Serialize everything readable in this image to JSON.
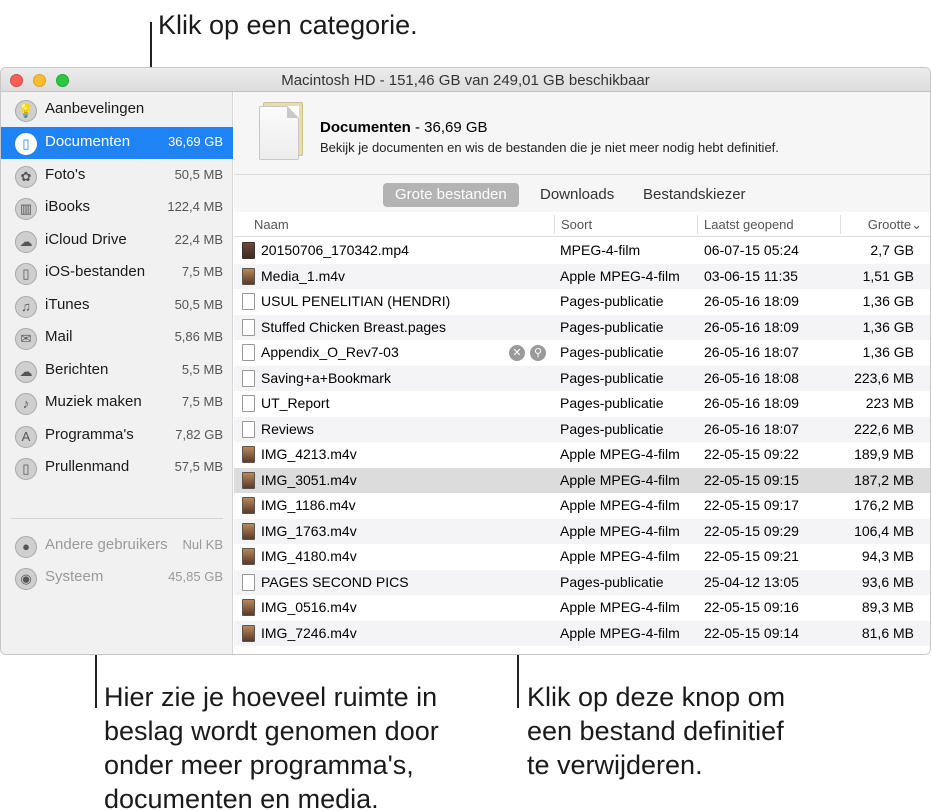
{
  "callouts": {
    "top": "Klik op een categorie.",
    "left": [
      "Hier zie je hoeveel ruimte in",
      "beslag wordt genomen door",
      "onder meer programma's,",
      "documenten en media."
    ],
    "right": [
      "Klik op deze knop om",
      "een bestand definitief",
      "te verwijderen."
    ]
  },
  "window": {
    "title": "Macintosh HD - 151,46 GB van 249,01 GB beschikbaar"
  },
  "sidebar": {
    "items": [
      {
        "label": "Aanbevelingen",
        "size": "",
        "icon": "lightbulb-icon"
      },
      {
        "label": "Documenten",
        "size": "36,69 GB",
        "icon": "document-icon"
      },
      {
        "label": "Foto's",
        "size": "50,5 MB",
        "icon": "photos-icon"
      },
      {
        "label": "iBooks",
        "size": "122,4 MB",
        "icon": "book-icon"
      },
      {
        "label": "iCloud Drive",
        "size": "22,4 MB",
        "icon": "cloud-icon"
      },
      {
        "label": "iOS-bestanden",
        "size": "7,5 MB",
        "icon": "phone-icon"
      },
      {
        "label": "iTunes",
        "size": "50,5 MB",
        "icon": "music-note-icon"
      },
      {
        "label": "Mail",
        "size": "5,86 MB",
        "icon": "stamp-icon"
      },
      {
        "label": "Berichten",
        "size": "5,5 MB",
        "icon": "speech-bubble-icon"
      },
      {
        "label": "Muziek maken",
        "size": "7,5 MB",
        "icon": "guitar-icon"
      },
      {
        "label": "Programma's",
        "size": "7,82 GB",
        "icon": "app-store-icon"
      },
      {
        "label": "Prullenmand",
        "size": "57,5 MB",
        "icon": "trash-icon"
      },
      {
        "label": "Andere gebruikers",
        "size": "Nul KB",
        "icon": "users-icon"
      },
      {
        "label": "Systeem",
        "size": "45,85 GB",
        "icon": "disk-icon"
      }
    ]
  },
  "header": {
    "title": "Documenten",
    "size": " - 36,69 GB",
    "description": "Bekijk je documenten en wis de bestanden die je niet meer nodig hebt definitief."
  },
  "tabs": [
    "Grote bestanden",
    "Downloads",
    "Bestandskiezer"
  ],
  "table": {
    "columns": [
      "Naam",
      "Soort",
      "Laatst geopend",
      "Grootte"
    ],
    "sort_indicator": "⌄",
    "rows": [
      {
        "name": "20150706_170342.mp4",
        "kind": "MPEG-4-film",
        "date": "06-07-15 05:24",
        "size": "2,7 GB",
        "icon": "film"
      },
      {
        "name": "Media_1.m4v",
        "kind": "Apple MPEG-4-film",
        "date": "03-06-15 11:35",
        "size": "1,51 GB",
        "icon": "img"
      },
      {
        "name": "USUL PENELITIAN (HENDRI)",
        "kind": "Pages-publicatie",
        "date": "26-05-16 18:09",
        "size": "1,36 GB",
        "icon": "pages"
      },
      {
        "name": "Stuffed Chicken Breast.pages",
        "kind": "Pages-publicatie",
        "date": "26-05-16 18:09",
        "size": "1,36 GB",
        "icon": "pages"
      },
      {
        "name": "Appendix_O_Rev7-03",
        "kind": "Pages-publicatie",
        "date": "26-05-16 18:07",
        "size": "1,36 GB",
        "icon": "pages"
      },
      {
        "name": "Saving+a+Bookmark",
        "kind": "Pages-publicatie",
        "date": "26-05-16 18:08",
        "size": "223,6 MB",
        "icon": "pages"
      },
      {
        "name": "UT_Report",
        "kind": "Pages-publicatie",
        "date": "26-05-16 18:09",
        "size": "223 MB",
        "icon": "pages"
      },
      {
        "name": "Reviews",
        "kind": "Pages-publicatie",
        "date": "26-05-16 18:07",
        "size": "222,6 MB",
        "icon": "pages"
      },
      {
        "name": "IMG_4213.m4v",
        "kind": "Apple MPEG-4-film",
        "date": "22-05-15 09:22",
        "size": "189,9 MB",
        "icon": "img"
      },
      {
        "name": "IMG_3051.m4v",
        "kind": "Apple MPEG-4-film",
        "date": "22-05-15 09:15",
        "size": "187,2 MB",
        "icon": "img"
      },
      {
        "name": "IMG_1186.m4v",
        "kind": "Apple MPEG-4-film",
        "date": "22-05-15 09:17",
        "size": "176,2 MB",
        "icon": "img"
      },
      {
        "name": "IMG_1763.m4v",
        "kind": "Apple MPEG-4-film",
        "date": "22-05-15 09:29",
        "size": "106,4 MB",
        "icon": "img"
      },
      {
        "name": "IMG_4180.m4v",
        "kind": "Apple MPEG-4-film",
        "date": "22-05-15 09:21",
        "size": "94,3 MB",
        "icon": "img"
      },
      {
        "name": "PAGES SECOND PICS",
        "kind": "Pages-publicatie",
        "date": "25-04-12 13:05",
        "size": "93,6 MB",
        "icon": "pages"
      },
      {
        "name": "IMG_0516.m4v",
        "kind": "Apple MPEG-4-film",
        "date": "22-05-15 09:16",
        "size": "89,3 MB",
        "icon": "img"
      },
      {
        "name": "IMG_7246.m4v",
        "kind": "Apple MPEG-4-film",
        "date": "22-05-15 09:14",
        "size": "81,6 MB",
        "icon": "img"
      }
    ]
  },
  "row_buttons": {
    "delete_glyph": "✕",
    "reveal_glyph": "⚲"
  }
}
